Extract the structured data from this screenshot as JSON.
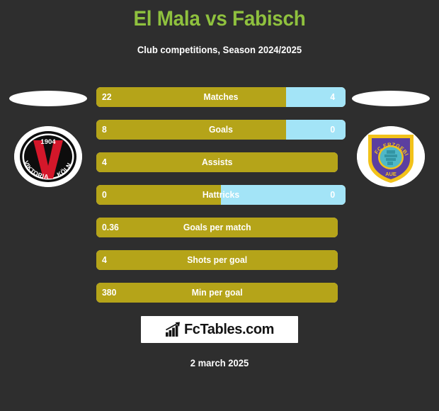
{
  "header": {
    "title": "El Mala vs Fabisch",
    "subtitle": "Club competitions, Season 2024/2025",
    "title_color": "#8fc13e",
    "background_color": "#2e2e2e"
  },
  "teams": {
    "home": {
      "name": "VIKTORIA KÖLN",
      "founded": "1904",
      "logo_icon": "viktoria-koln-crest-icon",
      "colors": {
        "primary": "#ffffff",
        "secondary": "#000000",
        "accent": "#d4172a"
      }
    },
    "away": {
      "name": "FC ERZGEBIRGE",
      "name_line2": "AUE",
      "logo_icon": "fc-erzgebirge-aue-crest-icon",
      "colors": {
        "primary": "#5b3fa0",
        "secondary": "#f2c21a",
        "accent": "#4fb8c8"
      }
    }
  },
  "bars": {
    "home_color": "#b5a419",
    "away_color": "#a3e4f7",
    "outline_color": "#e8e0b0"
  },
  "chart_data": {
    "type": "bar",
    "title": "El Mala vs Fabisch",
    "subtitle": "Club competitions, Season 2024/2025",
    "orientation": "horizontal-split",
    "series": [
      {
        "name": "El Mala",
        "color": "#b5a419"
      },
      {
        "name": "Fabisch",
        "color": "#a3e4f7"
      }
    ],
    "categories": [
      "Matches",
      "Goals",
      "Assists",
      "Hattricks",
      "Goals per match",
      "Shots per goal",
      "Min per goal"
    ],
    "rows": [
      {
        "label": "Matches",
        "home": "22",
        "away": "4",
        "home_pct": 76,
        "away_pct": 24,
        "split": true,
        "width_pct": 100
      },
      {
        "label": "Goals",
        "home": "8",
        "away": "0",
        "home_pct": 76,
        "away_pct": 24,
        "split": true,
        "width_pct": 100
      },
      {
        "label": "Assists",
        "home": "4",
        "away": "",
        "home_pct": 100,
        "away_pct": 0,
        "split": false,
        "width_pct": 97
      },
      {
        "label": "Hattricks",
        "home": "0",
        "away": "0",
        "home_pct": 50,
        "away_pct": 50,
        "split": true,
        "width_pct": 100
      },
      {
        "label": "Goals per match",
        "home": "0.36",
        "away": "",
        "home_pct": 100,
        "away_pct": 0,
        "split": false,
        "width_pct": 97
      },
      {
        "label": "Shots per goal",
        "home": "4",
        "away": "",
        "home_pct": 100,
        "away_pct": 0,
        "split": false,
        "width_pct": 97
      },
      {
        "label": "Min per goal",
        "home": "380",
        "away": "",
        "home_pct": 100,
        "away_pct": 0,
        "split": false,
        "width_pct": 97
      }
    ]
  },
  "footer": {
    "brand": "FcTables.com",
    "brand_icon": "bar-chart-growth-icon",
    "date": "2 march 2025"
  }
}
